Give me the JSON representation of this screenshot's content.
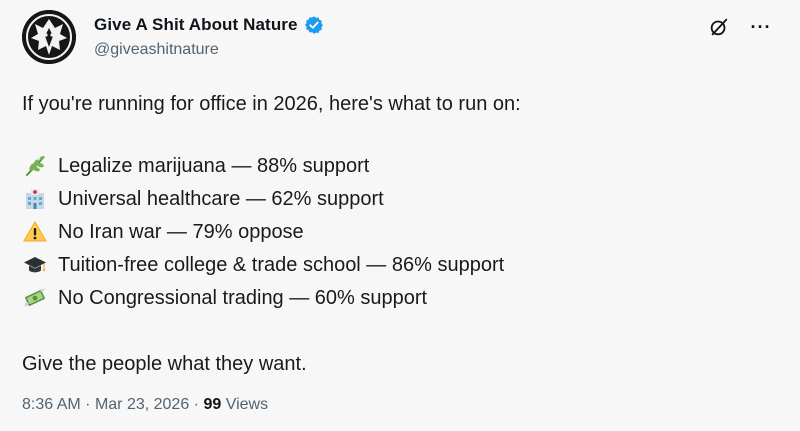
{
  "author": {
    "display_name": "Give A Shit About Nature",
    "handle": "@giveashitnature",
    "verified": true,
    "avatar_icon": "wolf-logo-icon"
  },
  "tweet": {
    "intro": "If you're running for office in 2026, here's what to run on:",
    "items": [
      {
        "emoji": "herb-icon",
        "text": "Legalize marijuana — 88% support"
      },
      {
        "emoji": "hospital-icon",
        "text": "Universal healthcare — 62% support"
      },
      {
        "emoji": "warning-icon",
        "text": "No Iran war — 79% oppose"
      },
      {
        "emoji": "graduation-cap-icon",
        "text": "Tuition-free college & trade school — 86% support"
      },
      {
        "emoji": "money-flying-icon",
        "text": "No Congressional trading — 60% support"
      }
    ],
    "outro": "Give the people what they want."
  },
  "meta": {
    "time": "8:36 AM",
    "date": "Mar 23, 2026",
    "separator": "·",
    "views_count": "99",
    "views_label": "Views"
  },
  "actions": {
    "grok_icon": "grok-icon",
    "more_label": "···"
  },
  "colors": {
    "verified": "#1d9bf0",
    "secondary_text": "#536471",
    "primary_text": "#0f1419"
  }
}
